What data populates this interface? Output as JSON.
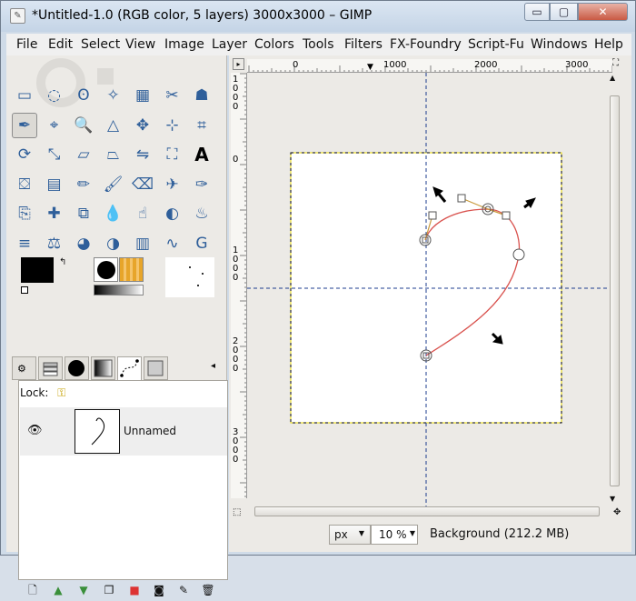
{
  "window": {
    "title": "*Untitled-1.0 (RGB color, 5 layers) 3000x3000 – GIMP",
    "minimize_glyph": "▭",
    "maximize_glyph": "▢",
    "close_glyph": "✕"
  },
  "menubar": {
    "items": [
      {
        "label": "File"
      },
      {
        "label": "Edit"
      },
      {
        "label": "Select"
      },
      {
        "label": "View"
      },
      {
        "label": "Image"
      },
      {
        "label": "Layer"
      },
      {
        "label": "Colors"
      },
      {
        "label": "Tools"
      },
      {
        "label": "Filters"
      },
      {
        "label": "FX-Foundry"
      },
      {
        "label": "Script-Fu"
      },
      {
        "label": "Windows"
      },
      {
        "label": "Help"
      }
    ]
  },
  "toolbox": {
    "tools": [
      "rect-select-icon",
      "ellipse-select-icon",
      "free-select-icon",
      "fuzzy-select-icon",
      "select-by-color-icon",
      "scissors-select-icon",
      "foreground-select-icon",
      "paths-tool-icon",
      "color-picker-icon",
      "zoom-icon",
      "measure-icon",
      "move-icon",
      "align-icon",
      "crop-icon",
      "rotate-icon",
      "scale-icon",
      "shear-icon",
      "perspective-icon",
      "flip-icon",
      "cage-icon",
      "text-icon",
      "bucket-fill-icon",
      "blend-icon",
      "pencil-icon",
      "paintbrush-icon",
      "eraser-icon",
      "airbrush-icon",
      "ink-icon",
      "clone-icon",
      "heal-icon",
      "perspective-clone-icon",
      "blur-icon",
      "smudge-icon",
      "dodge-burn-icon",
      "warp-icon",
      "levels-icon",
      "color-balance-icon",
      "hue-icon",
      "threshold-icon",
      "histogram-icon",
      "curves-icon",
      "g-icon"
    ],
    "foreground_color": "#000000",
    "background_color": "#ffffff"
  },
  "dock": {
    "lock_label": "Lock:",
    "layer_name": "Unnamed"
  },
  "canvas": {
    "top_ruler_labels": [
      "0",
      "1000",
      "2000",
      "3000"
    ],
    "left_ruler_labels": [
      "1000",
      "0",
      "1000",
      "2000",
      "3000"
    ],
    "accent_path_color": "#d9534f",
    "guide_color": "#1d3c8f"
  },
  "statusbar": {
    "unit": "px",
    "zoom": "10 %",
    "message": "Background (212.2 MB)"
  }
}
